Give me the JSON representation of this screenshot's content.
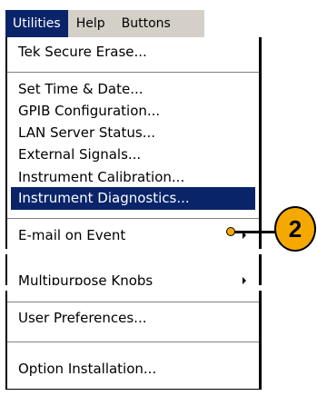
{
  "menubar": {
    "items": [
      {
        "label": "Utilities"
      },
      {
        "label": "Help"
      },
      {
        "label": "Buttons"
      }
    ]
  },
  "menu": {
    "tek_secure_erase": "Tek Secure Erase...",
    "set_time_date": "Set Time & Date...",
    "gpib_configuration": "GPIB Configuration...",
    "lan_server_status": "LAN Server Status...",
    "external_signals": "External Signals...",
    "instrument_calibration": "Instrument Calibration...",
    "instrument_diagnostics": "Instrument Diagnostics...",
    "email_on_event": "E-mail on Event",
    "multipurpose_knobs": "Multipurpose Knobs",
    "user_preferences": "User Preferences...",
    "option_installation": "Option Installation..."
  },
  "callout": {
    "number": "2"
  },
  "colors": {
    "highlight": "#0a246a",
    "callout": "#f5a800",
    "menubar": "#d4d0c8"
  },
  "icons": {
    "submenu": "chevron-right-icon"
  }
}
